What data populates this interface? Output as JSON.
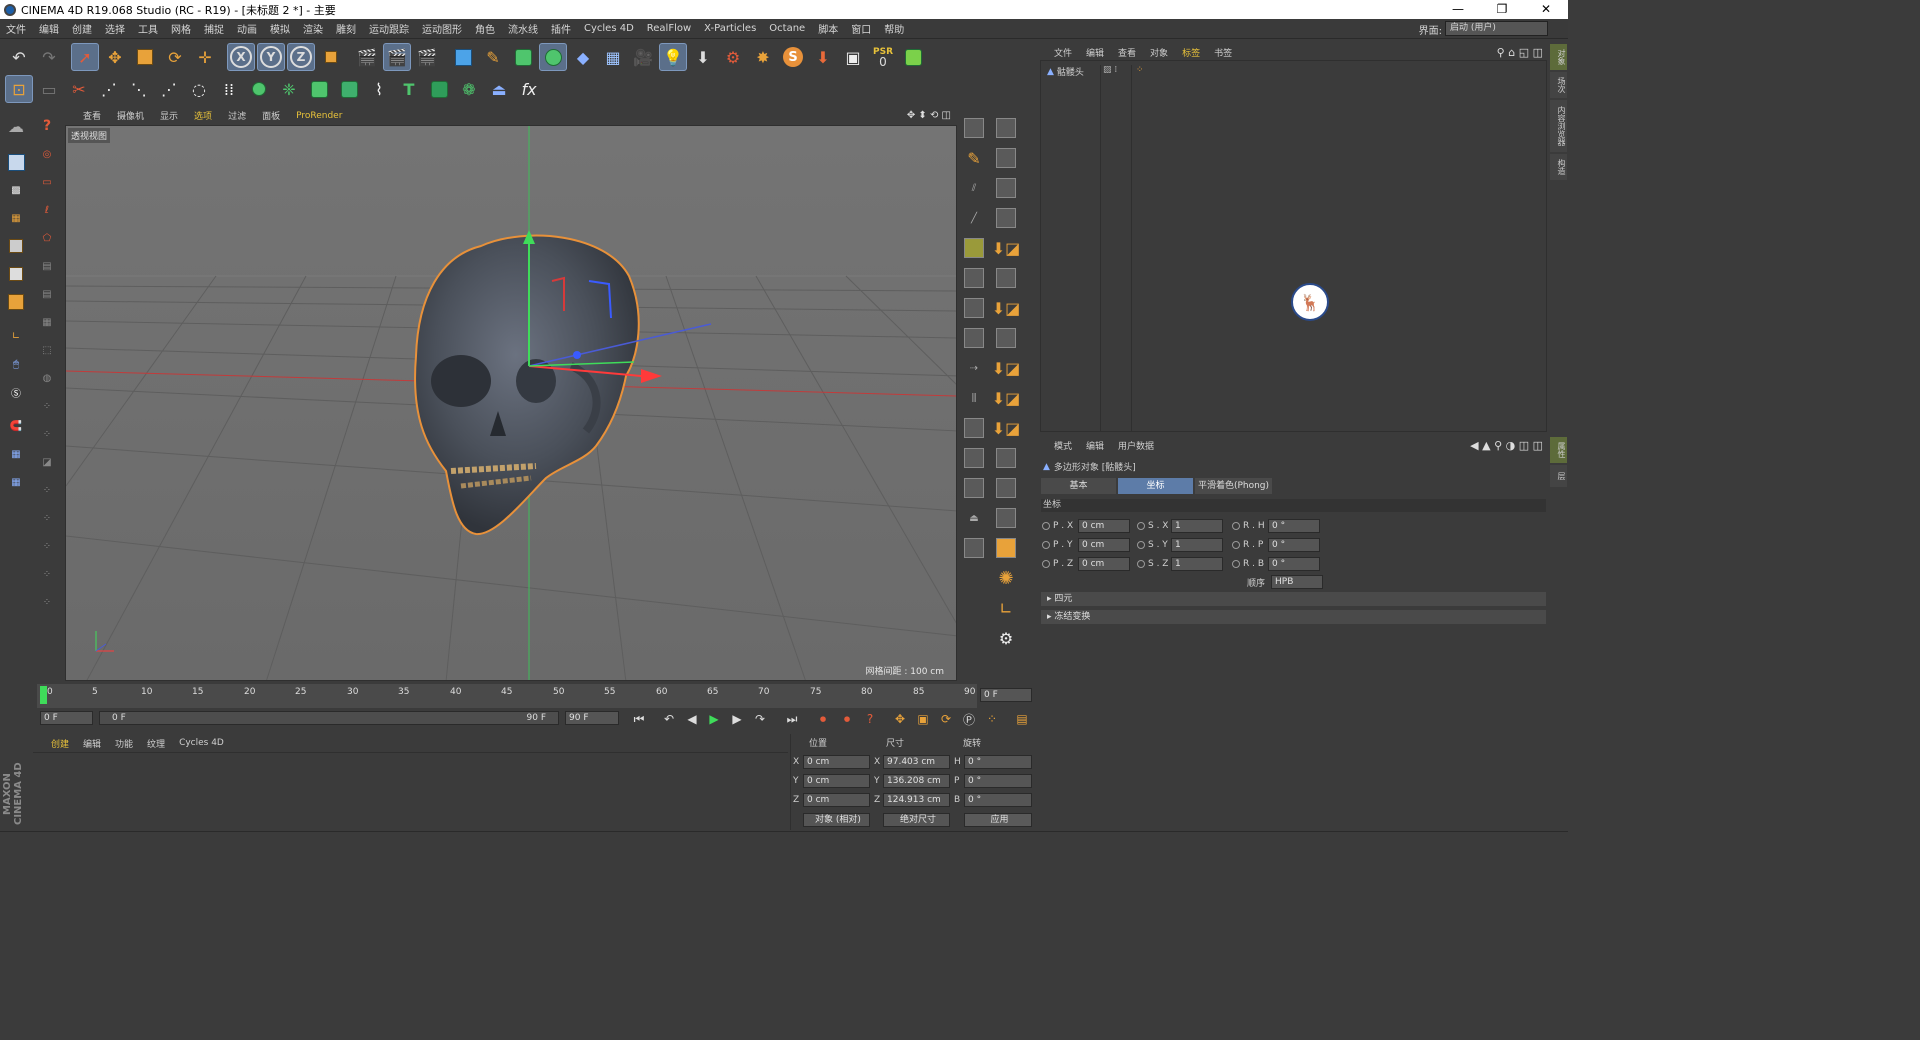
{
  "window": {
    "title": "CINEMA 4D R19.068 Studio (RC - R19) - [未标题 2 *] - 主要",
    "controls": [
      "—",
      "❐",
      "✕"
    ]
  },
  "menu": [
    "文件",
    "编辑",
    "创建",
    "选择",
    "工具",
    "网格",
    "捕捉",
    "动画",
    "模拟",
    "渲染",
    "雕刻",
    "运动跟踪",
    "运动图形",
    "角色",
    "流水线",
    "插件",
    "Cycles 4D",
    "RealFlow",
    "X-Particles",
    "Octane",
    "脚本",
    "窗口",
    "帮助"
  ],
  "layout": {
    "label": "界面:",
    "value": "启动 (用户)"
  },
  "toolbar": {
    "psr_label": "PSR",
    "psr_value": "0"
  },
  "viewport": {
    "menu": [
      "查看",
      "摄像机",
      "显示",
      "选项",
      "过滤",
      "面板",
      "ProRender"
    ],
    "view_name": "透视视图",
    "grid_spacing": "网格间距 : 100 cm"
  },
  "timeline": {
    "ticks": [
      "0",
      "5",
      "10",
      "15",
      "20",
      "25",
      "30",
      "35",
      "40",
      "45",
      "50",
      "55",
      "60",
      "65",
      "70",
      "75",
      "80",
      "85",
      "90"
    ],
    "current_frame": "0 F",
    "start": "0 F",
    "range_start": "0 F",
    "range_end": "90 F",
    "end": "90 F"
  },
  "material_manager": {
    "menu": [
      "创建",
      "编辑",
      "功能",
      "纹理",
      "Cycles 4D"
    ]
  },
  "coordinates": {
    "headers": {
      "position": "位置",
      "size": "尺寸",
      "rotation": "旋转"
    },
    "rows": [
      {
        "axis": "X",
        "pos": "0 cm",
        "size_axis": "X",
        "size": "97.403 cm",
        "rot_axis": "H",
        "rot": "0 °"
      },
      {
        "axis": "Y",
        "pos": "0 cm",
        "size_axis": "Y",
        "size": "136.208 cm",
        "rot_axis": "P",
        "rot": "0 °"
      },
      {
        "axis": "Z",
        "pos": "0 cm",
        "size_axis": "Z",
        "size": "124.913 cm",
        "rot_axis": "B",
        "rot": "0 °"
      }
    ],
    "mode": "对象 (相对)",
    "size_mode": "绝对尺寸",
    "apply": "应用"
  },
  "object_manager": {
    "menu": [
      "文件",
      "编辑",
      "查看",
      "对象",
      "标签",
      "书签"
    ],
    "objects": [
      {
        "name": "骷髅头"
      }
    ]
  },
  "attribute_manager": {
    "menu": [
      "模式",
      "编辑",
      "用户数据"
    ],
    "object_title": "多边形对象 [骷髅头]",
    "tabs": [
      "基本",
      "坐标",
      "平滑着色(Phong)"
    ],
    "active_tab": "坐标",
    "section": "坐标",
    "props": [
      {
        "label": "P . X",
        "value": "0 cm"
      },
      {
        "label": "P . Y",
        "value": "0 cm"
      },
      {
        "label": "P . Z",
        "value": "0 cm"
      },
      {
        "label": "S . X",
        "value": "1"
      },
      {
        "label": "S . Y",
        "value": "1"
      },
      {
        "label": "S . Z",
        "value": "1"
      },
      {
        "label": "R . H",
        "value": "0 °"
      },
      {
        "label": "R . P",
        "value": "0 °"
      },
      {
        "label": "R . B",
        "value": "0 °"
      }
    ],
    "order_label": "顺序",
    "order_value": "HPB",
    "collapsed": [
      "四元",
      "冻结变换"
    ]
  },
  "side_tabs": [
    "对象",
    "场次",
    "内容浏览器",
    "构造",
    "属性",
    "层"
  ],
  "brand": "MAXON CINEMA 4D",
  "colors": {
    "accent": "#5d7ca8",
    "viewport_bg": "#6d6d6d",
    "selection": "#e8913a"
  }
}
